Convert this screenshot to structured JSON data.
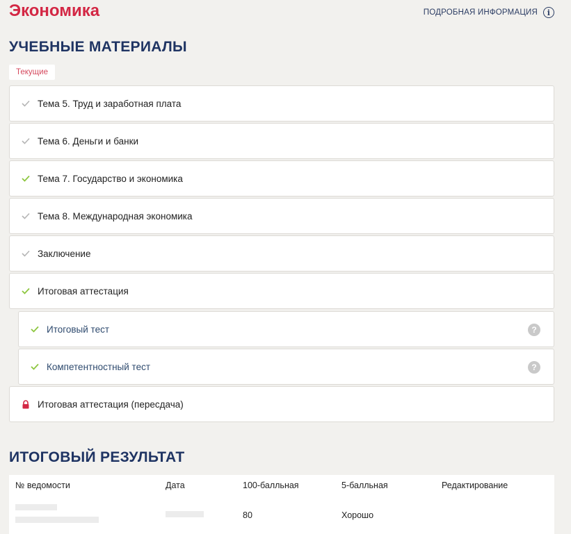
{
  "course": {
    "title": "Экономика",
    "info_link": "ПОДРОБНАЯ ИНФОРМАЦИЯ"
  },
  "materials": {
    "title": "УЧЕБНЫЕ МАТЕРИАЛЫ",
    "tab_current": "Текущие",
    "items": [
      {
        "label": "Тема 5. Труд и заработная плата",
        "status": "viewed"
      },
      {
        "label": "Тема 6. Деньги и банки",
        "status": "viewed"
      },
      {
        "label": "Тема 7. Государство и экономика",
        "status": "completed"
      },
      {
        "label": "Тема 8. Международная экономика",
        "status": "viewed"
      },
      {
        "label": "Заключение",
        "status": "viewed"
      },
      {
        "label": "Итоговая аттестация",
        "status": "completed"
      },
      {
        "label": "Итоговый тест",
        "status": "completed"
      },
      {
        "label": "Компетентностный тест",
        "status": "completed"
      },
      {
        "label": "Итоговая аттестация (пересдача)",
        "status": "locked"
      }
    ]
  },
  "results": {
    "title": "ИТОГОВЫЙ РЕЗУЛЬТАТ",
    "columns": [
      "№ ведомости",
      "Дата",
      "100-балльная",
      "5-балльная",
      "Редактирование"
    ],
    "rows": [
      {
        "score100": "80",
        "score5": "Хорошо"
      }
    ]
  },
  "colors": {
    "brand": "#d32744",
    "heading": "#1f3463",
    "check_completed": "#8dc63f",
    "check_viewed": "#b5b5b5",
    "lock": "#d32744"
  }
}
